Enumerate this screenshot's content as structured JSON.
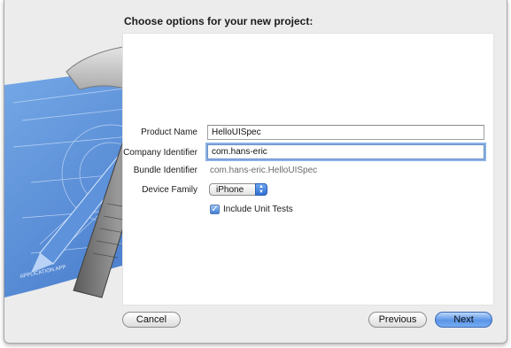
{
  "dialog": {
    "title": "Choose options for your new project:"
  },
  "form": {
    "product_name": {
      "label": "Product Name",
      "value": "HelloUISpec"
    },
    "company_identifier": {
      "label": "Company Identifier",
      "value": "com.hans-eric"
    },
    "bundle_identifier": {
      "label": "Bundle Identifier",
      "value": "com.hans-eric.HelloUISpec"
    },
    "device_family": {
      "label": "Device Family",
      "value": "iPhone"
    },
    "unit_tests": {
      "label": "Include Unit Tests",
      "checked": true
    }
  },
  "buttons": {
    "cancel": "Cancel",
    "previous": "Previous",
    "next": "Next"
  },
  "artwork": {
    "icon": "xcode-hammer-blueprint-icon",
    "blueprint_text": "APPLICATION.APP"
  },
  "colors": {
    "accent": "#4a8ae6",
    "focus_ring": "#89b1e6",
    "blueprint": "#3b74c8"
  }
}
